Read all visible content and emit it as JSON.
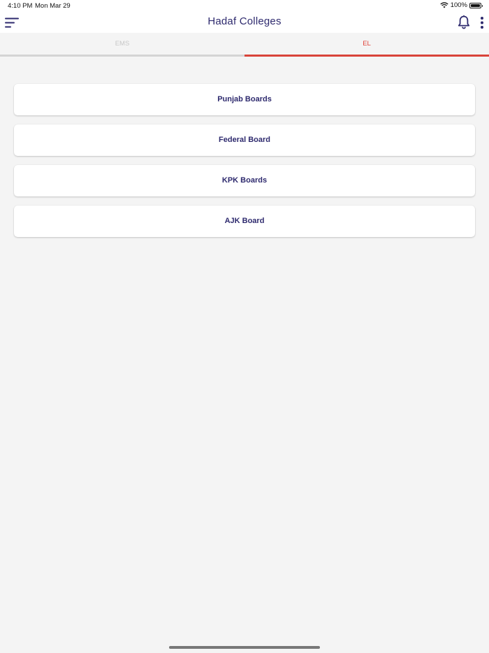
{
  "status_bar": {
    "time": "4:10 PM",
    "date": "Mon Mar 29",
    "battery": "100%"
  },
  "header": {
    "title": "Hadaf Colleges",
    "menu_icon": "hamburger-menu-icon",
    "bell_icon": "bell-icon",
    "more_icon": "vertical-dots-icon"
  },
  "tabs": [
    {
      "label": "EMS",
      "active": false
    },
    {
      "label": "EL",
      "active": true
    }
  ],
  "boards": [
    {
      "label": "Punjab Boards"
    },
    {
      "label": "Federal Board"
    },
    {
      "label": "KPK Boards"
    },
    {
      "label": "AJK Board"
    }
  ],
  "colors": {
    "primary": "#2e2a6e",
    "accent": "#e0433a",
    "background": "#f4f4f4"
  }
}
